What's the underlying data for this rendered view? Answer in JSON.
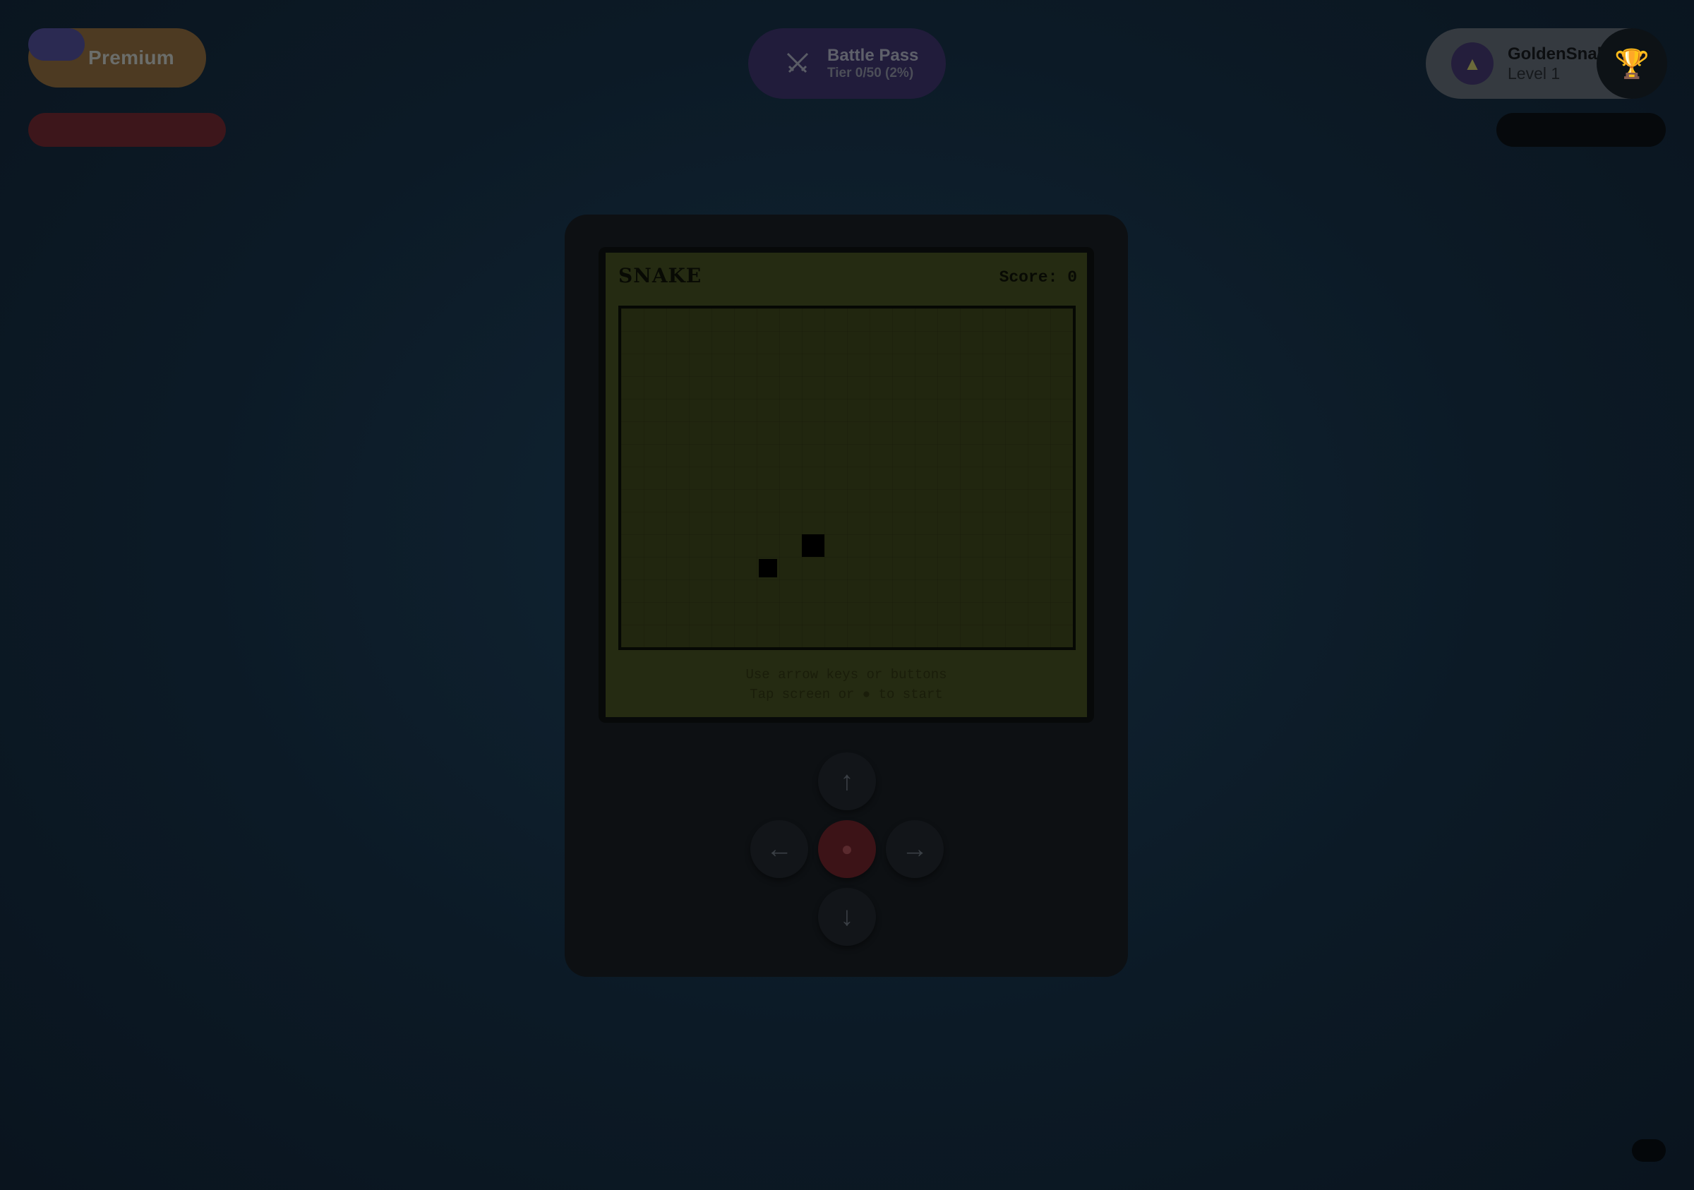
{
  "header": {
    "premium_label": "Premium",
    "battle_pass": {
      "title": "Battle Pass",
      "tier": "Tier 0/50 (2%)",
      "progress_percent": 2
    },
    "user": {
      "name": "GoldenSnal",
      "level": "Level 1",
      "avatar_icon": "hat-icon"
    },
    "trophy_icon": "trophy-icon"
  },
  "game": {
    "title": "SNAKE",
    "score_label": "Score: 0",
    "score": 0,
    "grid": {
      "cols": 20,
      "rows": 15
    },
    "snake": [
      {
        "col": 6,
        "row": 11
      }
    ],
    "food": {
      "col": 8,
      "row": 10
    },
    "instructions": [
      "Use arrow keys or buttons",
      "Tap screen or ● to start"
    ]
  },
  "controls": {
    "up": "↑",
    "down": "↓",
    "left": "←",
    "right": "→",
    "center": "●"
  },
  "colors": {
    "screen_bg": "#252b12",
    "center_button": "#3c1317",
    "premium": "#4d3a22"
  }
}
